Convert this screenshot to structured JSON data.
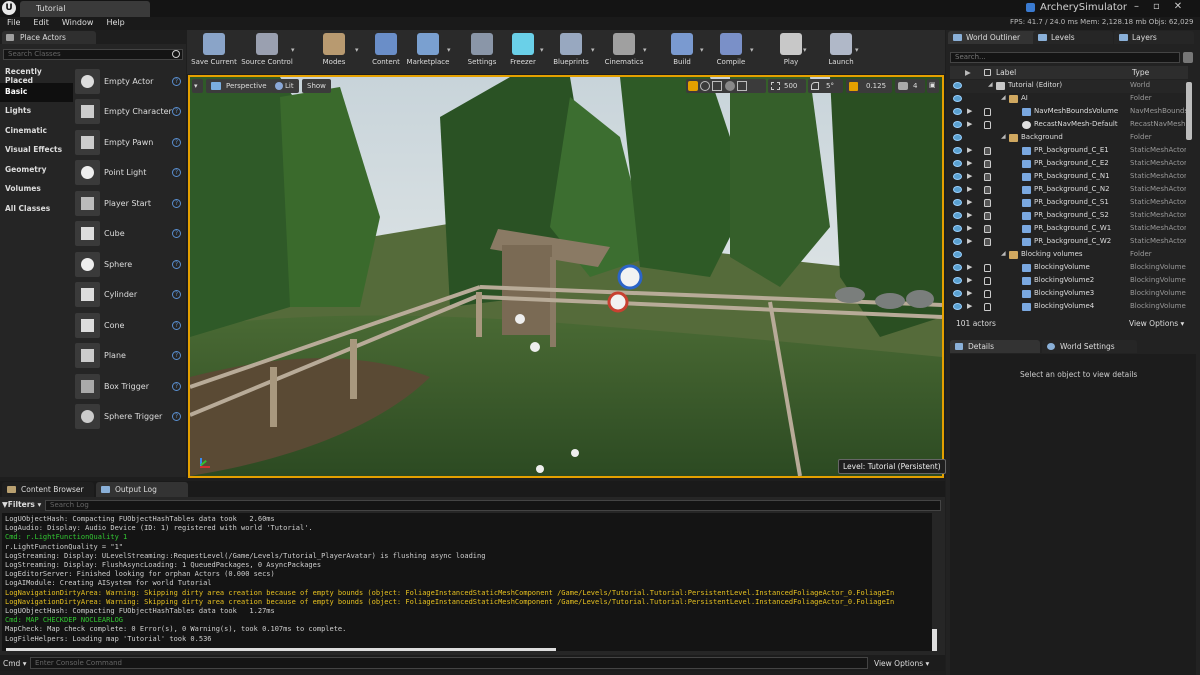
{
  "title_bar": {
    "doc_tab": "Tutorial",
    "project_name": "ArcherySimulator",
    "window_buttons": "–▫✕"
  },
  "menu": [
    "File",
    "Edit",
    "Window",
    "Help"
  ],
  "stats": "FPS: 41.7  /  24.0 ms   Mem: 2,128.18 mb   Objs: 62,029",
  "place_actors": {
    "tab": "Place Actors",
    "search_placeholder": "Search Classes",
    "categories": [
      "Recently Placed",
      "Basic",
      "Lights",
      "Cinematic",
      "Visual Effects",
      "Geometry",
      "Volumes",
      "All Classes"
    ],
    "selected_category": "Basic",
    "items": [
      "Empty Actor",
      "Empty Character",
      "Empty Pawn",
      "Point Light",
      "Player Start",
      "Cube",
      "Sphere",
      "Cylinder",
      "Cone",
      "Plane",
      "Box Trigger",
      "Sphere Trigger"
    ],
    "help_glyph": "?"
  },
  "toolbar": [
    {
      "label": "Save Current",
      "icon": "save-icon",
      "color": "#8aa4c8"
    },
    {
      "label": "Source Control",
      "icon": "source-control-icon",
      "color": "#9aa0b0"
    },
    {
      "label": "Modes",
      "icon": "modes-icon",
      "color": "#b89a70"
    },
    {
      "label": "Content",
      "icon": "content-icon",
      "color": "#6a8ec8"
    },
    {
      "label": "Marketplace",
      "icon": "marketplace-icon",
      "color": "#7aa0d0"
    },
    {
      "label": "Settings",
      "icon": "settings-icon",
      "color": "#8a96a8"
    },
    {
      "label": "Freezer",
      "icon": "freezer-icon",
      "color": "#6ad0e8"
    },
    {
      "label": "Blueprints",
      "icon": "blueprints-icon",
      "color": "#98a8c0"
    },
    {
      "label": "Cinematics",
      "icon": "cinematics-icon",
      "color": "#a0a0a0"
    },
    {
      "label": "Build",
      "icon": "build-icon",
      "color": "#7a9ad0"
    },
    {
      "label": "Compile",
      "icon": "compile-icon",
      "color": "#7a90c8"
    },
    {
      "label": "Play",
      "icon": "play-icon",
      "color": "#c8c8c8"
    },
    {
      "label": "Launch",
      "icon": "launch-icon",
      "color": "#b0b8c8"
    }
  ],
  "viewport": {
    "perspective": "Perspective",
    "lit": "Lit",
    "show": "Show",
    "grid_size": "500",
    "rotation_snap": "5°",
    "scale_snap": "0.125",
    "camera_speed": "4",
    "level_label": "Level:  Tutorial (Persistent)",
    "accent": "#e4a000"
  },
  "bottom": {
    "tabs": [
      "Content Browser",
      "Output Log"
    ],
    "filters": "▼Filters ▾",
    "search_placeholder": "Search Log",
    "log": [
      {
        "t": "LogUObjectHash: Compacting FUObjectHashTables data took   2.60ms",
        "c": "w"
      },
      {
        "t": "LogAudio: Display: Audio Device (ID: 1) registered with world 'Tutorial'.",
        "c": "w"
      },
      {
        "t": "Cmd: r.LightFunctionQuality 1",
        "c": "g"
      },
      {
        "t": "r.LightFunctionQuality = \"1\"",
        "c": "w"
      },
      {
        "t": "LogStreaming: Display: ULevelStreaming::RequestLevel(/Game/Levels/Tutorial_PlayerAvatar) is flushing async loading",
        "c": "w"
      },
      {
        "t": "LogStreaming: Display: FlushAsyncLoading: 1 QueuedPackages, 0 AsyncPackages",
        "c": "w"
      },
      {
        "t": "LogEditorServer: Finished looking for orphan Actors (0.000 secs)",
        "c": "w"
      },
      {
        "t": "LogAIModule: Creating AISystem for world Tutorial",
        "c": "w"
      },
      {
        "t": "LogNavigationDirtyArea: Warning: Skipping dirty area creation because of empty bounds (object: FoliageInstancedStaticMeshComponent /Game/Levels/Tutorial.Tutorial:PersistentLevel.InstancedFoliageActor_0.FoliageIn",
        "c": "y"
      },
      {
        "t": "LogNavigationDirtyArea: Warning: Skipping dirty area creation because of empty bounds (object: FoliageInstancedStaticMeshComponent /Game/Levels/Tutorial.Tutorial:PersistentLevel.InstancedFoliageActor_0.FoliageIn",
        "c": "y"
      },
      {
        "t": "LogUObjectHash: Compacting FUObjectHashTables data took   1.27ms",
        "c": "w"
      },
      {
        "t": "Cmd: MAP CHECKDEP NOCLEARLOG",
        "c": "g"
      },
      {
        "t": "MapCheck: Map check complete: 0 Error(s), 0 Warning(s), took 0.107ms to complete.",
        "c": "w"
      },
      {
        "t": "LogFileHelpers: Loading map 'Tutorial' took 0.536",
        "c": "w"
      }
    ],
    "cmd_label": "Cmd ▾",
    "cmd_placeholder": "Enter Console Command",
    "view_options": "View Options ▾"
  },
  "outliner": {
    "tabs": [
      "World Outliner",
      "Levels",
      "Layers"
    ],
    "search_placeholder": "Search...",
    "col_label": "Label",
    "col_type": "Type",
    "rows": [
      {
        "label": "Tutorial (Editor)",
        "type": "World",
        "indent": 1,
        "kind": "world"
      },
      {
        "label": "AI",
        "type": "Folder",
        "indent": 2,
        "kind": "folder"
      },
      {
        "label": "NavMeshBoundsVolume",
        "type": "NavMeshBounds",
        "indent": 3,
        "kind": "mesh"
      },
      {
        "label": "RecastNavMesh-Default",
        "type": "RecastNavMesh",
        "indent": 3,
        "kind": "sphere"
      },
      {
        "label": "Background",
        "type": "Folder",
        "indent": 2,
        "kind": "folder"
      },
      {
        "label": "PR_background_C_E1",
        "type": "StaticMeshActor",
        "indent": 3,
        "kind": "mesh",
        "lock": true
      },
      {
        "label": "PR_background_C_E2",
        "type": "StaticMeshActor",
        "indent": 3,
        "kind": "mesh",
        "lock": true
      },
      {
        "label": "PR_background_C_N1",
        "type": "StaticMeshActor",
        "indent": 3,
        "kind": "mesh",
        "lock": true
      },
      {
        "label": "PR_background_C_N2",
        "type": "StaticMeshActor",
        "indent": 3,
        "kind": "mesh",
        "lock": true
      },
      {
        "label": "PR_background_C_S1",
        "type": "StaticMeshActor",
        "indent": 3,
        "kind": "mesh",
        "lock": true
      },
      {
        "label": "PR_background_C_S2",
        "type": "StaticMeshActor",
        "indent": 3,
        "kind": "mesh",
        "lock": true
      },
      {
        "label": "PR_background_C_W1",
        "type": "StaticMeshActor",
        "indent": 3,
        "kind": "mesh",
        "lock": true
      },
      {
        "label": "PR_background_C_W2",
        "type": "StaticMeshActor",
        "indent": 3,
        "kind": "mesh",
        "lock": true
      },
      {
        "label": "Blocking volumes",
        "type": "Folder",
        "indent": 2,
        "kind": "folder"
      },
      {
        "label": "BlockingVolume",
        "type": "BlockingVolume",
        "indent": 3,
        "kind": "mesh"
      },
      {
        "label": "BlockingVolume2",
        "type": "BlockingVolume",
        "indent": 3,
        "kind": "mesh"
      },
      {
        "label": "BlockingVolume3",
        "type": "BlockingVolume",
        "indent": 3,
        "kind": "mesh"
      },
      {
        "label": "BlockingVolume4",
        "type": "BlockingVolume",
        "indent": 3,
        "kind": "mesh"
      }
    ],
    "actor_count": "101 actors",
    "view_options": "View Options ▾"
  },
  "details": {
    "tabs": [
      "Details",
      "World Settings"
    ],
    "message": "Select an object to view details"
  }
}
